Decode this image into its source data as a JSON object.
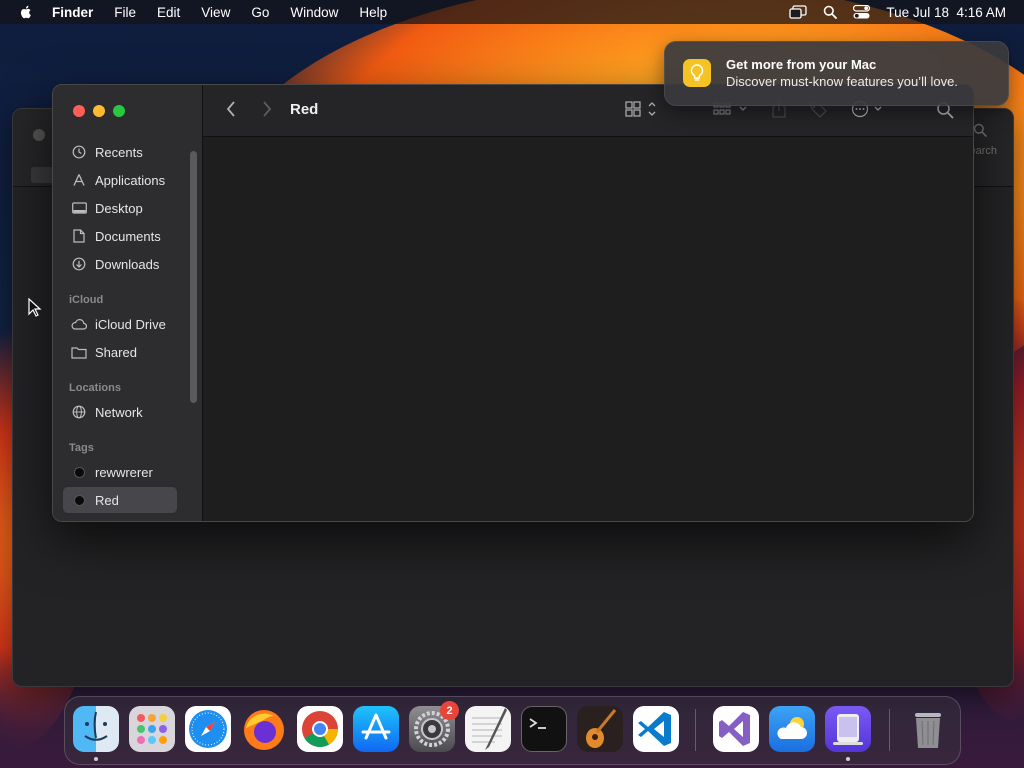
{
  "menubar": {
    "app_name": "Finder",
    "items": [
      "File",
      "Edit",
      "View",
      "Go",
      "Window",
      "Help"
    ],
    "clock": "Tue Jul 18  4:16 AM"
  },
  "background_window": {
    "search_label": "Search"
  },
  "finder": {
    "title": "Red",
    "sidebar": {
      "favorites": [
        {
          "label": "Recents",
          "icon": "clock-icon"
        },
        {
          "label": "Applications",
          "icon": "applications-icon"
        },
        {
          "label": "Desktop",
          "icon": "desktop-icon"
        },
        {
          "label": "Documents",
          "icon": "document-icon"
        },
        {
          "label": "Downloads",
          "icon": "download-icon"
        }
      ],
      "icloud_header": "iCloud",
      "icloud": [
        {
          "label": "iCloud Drive",
          "icon": "cloud-icon"
        },
        {
          "label": "Shared",
          "icon": "shared-folder-icon"
        }
      ],
      "locations_header": "Locations",
      "locations": [
        {
          "label": "Network",
          "icon": "globe-icon"
        }
      ],
      "tags_header": "Tags",
      "tags": [
        {
          "label": "rewwrerer",
          "color": "#000000"
        },
        {
          "label": "Red",
          "color": "#000000",
          "selected": true
        }
      ]
    }
  },
  "notification": {
    "title": "Get more from your Mac",
    "body": "Discover must-know features you’ll love.",
    "icon": "lightbulb-icon",
    "icon_color": "#f6c324"
  },
  "dock": {
    "apps": [
      {
        "name": "Finder",
        "icon": "finder-icon",
        "running": true
      },
      {
        "name": "Launchpad",
        "icon": "launchpad-icon"
      },
      {
        "name": "Safari",
        "icon": "safari-icon"
      },
      {
        "name": "Firefox",
        "icon": "firefox-icon"
      },
      {
        "name": "Chrome",
        "icon": "chrome-icon"
      },
      {
        "name": "App Store",
        "icon": "app-store-icon"
      },
      {
        "name": "System Settings",
        "icon": "system-settings-icon",
        "badge": "2"
      },
      {
        "name": "TextEdit",
        "icon": "textedit-icon"
      },
      {
        "name": "Terminal",
        "icon": "terminal-icon"
      },
      {
        "name": "GarageBand",
        "icon": "garageband-icon"
      },
      {
        "name": "Visual Studio Code",
        "icon": "vscode-icon"
      },
      {
        "name": "Visual Studio",
        "icon": "visual-studio-icon"
      },
      {
        "name": "Weather",
        "icon": "weather-icon"
      },
      {
        "name": "Simulator",
        "icon": "simulator-icon",
        "running": true
      },
      {
        "name": "Trash",
        "icon": "trash-icon"
      }
    ]
  }
}
